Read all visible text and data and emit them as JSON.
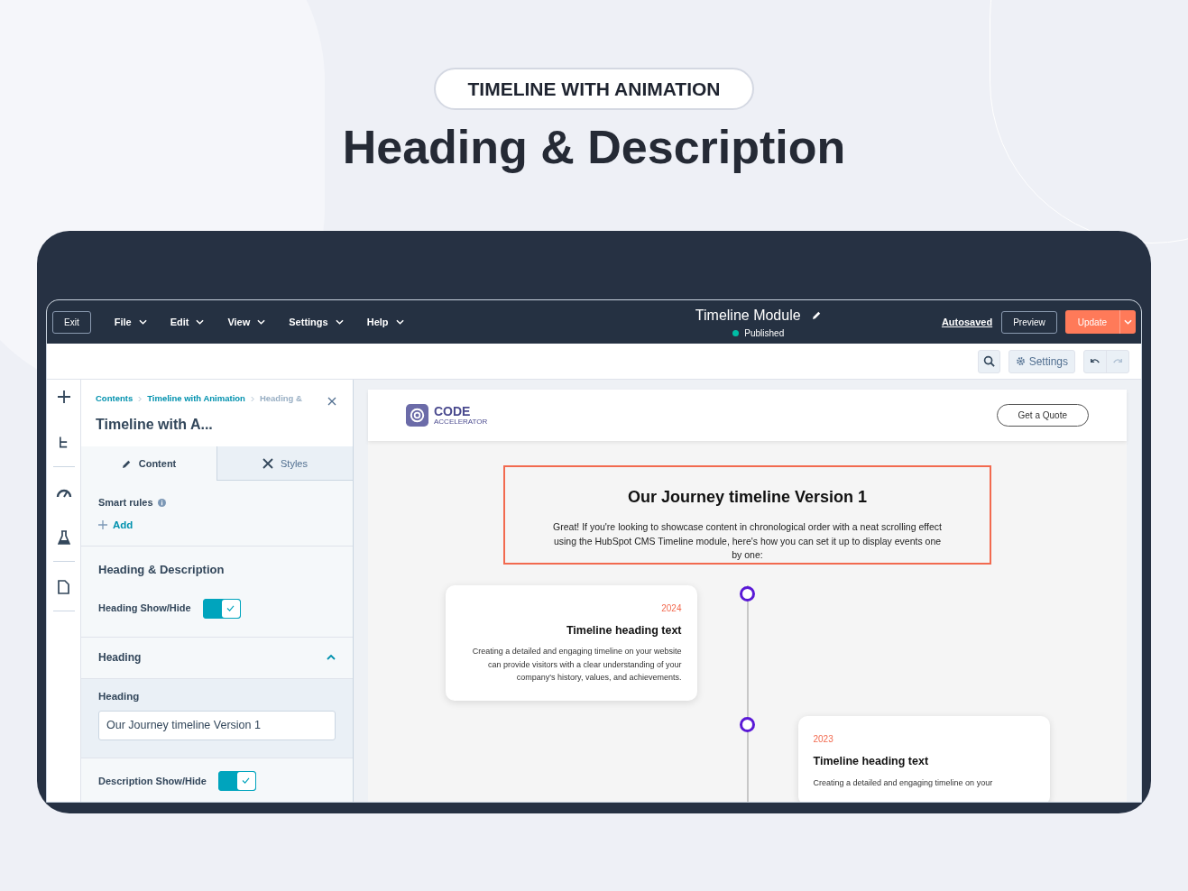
{
  "badge": "TIMELINE WITH ANIMATION",
  "headline": "Heading & Description",
  "editor": {
    "exit": "Exit",
    "menus": [
      "File",
      "Edit",
      "View",
      "Settings",
      "Help"
    ],
    "title": "Timeline Module",
    "status": "Published",
    "autosaved": "Autosaved",
    "preview": "Preview",
    "update": "Update",
    "toolbar_settings": "Settings",
    "breadcrumb": [
      {
        "label": "Contents",
        "current": false
      },
      {
        "label": "Timeline with Animation",
        "current": false
      },
      {
        "label": "Heading &",
        "current": true
      }
    ],
    "panel_title": "Timeline with A...",
    "tabs": [
      {
        "label": "Content",
        "kind": "pencil",
        "selected": true
      },
      {
        "label": "Styles",
        "kind": "brush",
        "selected": false
      }
    ],
    "smart_rules": "Smart rules",
    "add": "Add",
    "section_title": "Heading & Description",
    "heading_toggle": {
      "label": "Heading Show/Hide",
      "on": true
    },
    "accordion": {
      "label": "Heading",
      "expanded": true
    },
    "field": {
      "label": "Heading",
      "value": "Our Journey timeline Version 1"
    },
    "description_toggle": {
      "label": "Description Show/Hide",
      "on": true
    }
  },
  "site": {
    "logo_word": "CODE",
    "logo_sub": "ACCELERATOR",
    "cta": "Get a Quote",
    "heading": "Our Journey timeline Version 1",
    "intro": "Great! If you're looking to showcase content in chronological order with a neat scrolling effect using the HubSpot CMS Timeline module, here's how you can set it up to display events one by one:",
    "timeline": [
      {
        "year": "2024",
        "title": "Timeline heading text",
        "body": "Creating a detailed and engaging timeline on your website can provide visitors with a clear understanding of your company's history, values, and achievements."
      },
      {
        "year": "2023",
        "title": "Timeline heading text",
        "body": "Creating a detailed and engaging timeline on your"
      }
    ]
  }
}
